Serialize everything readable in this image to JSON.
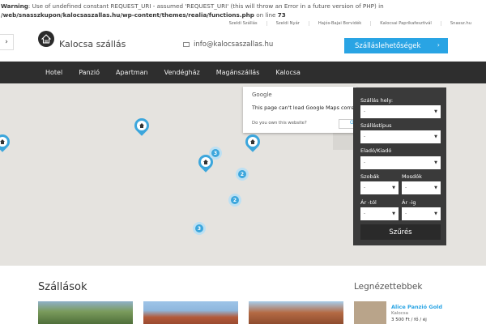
{
  "warning": {
    "prefix": "Warning",
    "text": ": Use of undefined constant REQUEST_URI - assumed 'REQUEST_URI' (this will throw an Error in a future version of PHP) in ",
    "path": "/web/snasszkupon/kalocsaszallas.hu/wp-content/themes/realia/functions.php",
    "online": " on line ",
    "line": "73"
  },
  "topnav": [
    "Szeldi Szállás",
    "Szeldi Nyár",
    "Hajós-Bajai Borvidék",
    "Kalocsai Paprikafesztivál",
    "Snassz.hu"
  ],
  "header": {
    "side_tab": "›",
    "site_title": "Kalocsa szállás",
    "email": "info@kalocsaszallas.hu",
    "cta_label": "Szálláslehetőségek",
    "cta_arrow": "›"
  },
  "mainnav": [
    "Hotel",
    "Panzió",
    "Apartman",
    "Vendégház",
    "Magánszállás",
    "Kalocsa"
  ],
  "gmaps": {
    "logo": "Google",
    "message": "This page can't load Google Maps correctly.",
    "own": "Do you own this website?",
    "ok": "OK"
  },
  "clusters": [
    "3",
    "2",
    "2",
    "3"
  ],
  "filter": {
    "hely_label": "Szállás hely:",
    "hely_value": "-",
    "tipus_label": "Szállástípus",
    "tipus_value": "-",
    "elado_label": "Eladó/Kiadó",
    "elado_value": "-",
    "szobak_label": "Szobák",
    "szobak_value": "-",
    "mosdok_label": "Mosdók",
    "mosdok_value": "-",
    "artol_label": "Ár -tól",
    "artol_value": "-",
    "arig_label": "Ár -ig",
    "arig_value": "-",
    "button": "Szűrés"
  },
  "sections": {
    "left_title": "Szállások",
    "right_title": "Legnézettebbek"
  },
  "recommended": {
    "title": "Alice Panzió Gold",
    "location": "Kalocsa",
    "price": "3 500 Ft / fő / éj"
  },
  "colors": {
    "accent": "#29a4e4",
    "nav_bg": "#2e2e2e",
    "filter_bg": "#3a3a3a",
    "map_bg": "#e5e3df"
  }
}
